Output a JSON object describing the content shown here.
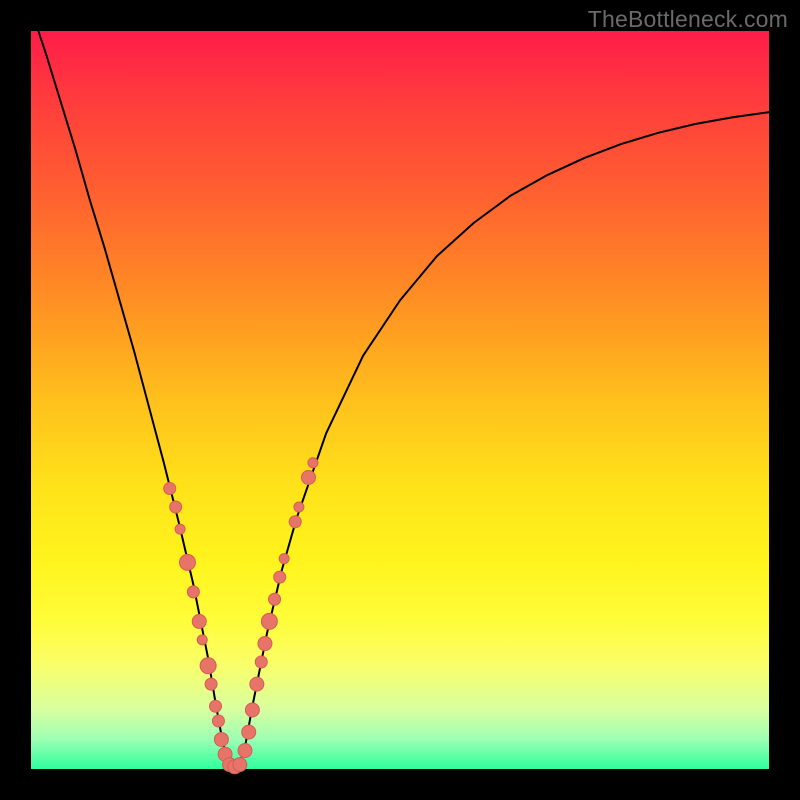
{
  "watermark": "TheBottleneck.com",
  "colors": {
    "frame": "#000000",
    "curve": "#000000",
    "scatter_fill": "#e77469",
    "scatter_stroke": "#d85c52"
  },
  "chart_data": {
    "type": "line",
    "title": "",
    "xlabel": "",
    "ylabel": "",
    "xlim": [
      0,
      100
    ],
    "ylim": [
      0,
      100
    ],
    "grid": false,
    "series": [
      {
        "name": "bottleneck-curve",
        "x": [
          0,
          2,
          4,
          6,
          8,
          10,
          12,
          14,
          16,
          18,
          20,
          22,
          24,
          25,
          26,
          27,
          28,
          29,
          30,
          32,
          34,
          36,
          40,
          45,
          50,
          55,
          60,
          65,
          70,
          75,
          80,
          85,
          90,
          95,
          100
        ],
        "y": [
          103,
          97,
          90.5,
          84,
          77,
          70.5,
          63.5,
          56.5,
          49,
          41.5,
          33.5,
          25,
          15,
          9,
          3.5,
          0,
          0,
          3,
          8.5,
          18.5,
          27,
          34,
          45.5,
          56,
          63.5,
          69.5,
          74,
          77.7,
          80.5,
          82.8,
          84.7,
          86.2,
          87.4,
          88.3,
          89
        ]
      }
    ],
    "scatter": {
      "name": "markers",
      "points": [
        {
          "x": 18.8,
          "y": 38.0,
          "r": 6
        },
        {
          "x": 19.6,
          "y": 35.5,
          "r": 6
        },
        {
          "x": 20.2,
          "y": 32.5,
          "r": 5
        },
        {
          "x": 21.2,
          "y": 28.0,
          "r": 8
        },
        {
          "x": 22.0,
          "y": 24.0,
          "r": 6
        },
        {
          "x": 22.8,
          "y": 20.0,
          "r": 7
        },
        {
          "x": 23.2,
          "y": 17.5,
          "r": 5
        },
        {
          "x": 24.0,
          "y": 14.0,
          "r": 8
        },
        {
          "x": 24.4,
          "y": 11.5,
          "r": 6
        },
        {
          "x": 25.0,
          "y": 8.5,
          "r": 6
        },
        {
          "x": 25.4,
          "y": 6.5,
          "r": 6
        },
        {
          "x": 25.8,
          "y": 4.0,
          "r": 7
        },
        {
          "x": 26.3,
          "y": 2.0,
          "r": 7
        },
        {
          "x": 26.9,
          "y": 0.6,
          "r": 7
        },
        {
          "x": 27.6,
          "y": 0.3,
          "r": 7
        },
        {
          "x": 28.3,
          "y": 0.6,
          "r": 7
        },
        {
          "x": 29.0,
          "y": 2.5,
          "r": 7
        },
        {
          "x": 29.5,
          "y": 5.0,
          "r": 7
        },
        {
          "x": 30.0,
          "y": 8.0,
          "r": 7
        },
        {
          "x": 30.6,
          "y": 11.5,
          "r": 7
        },
        {
          "x": 31.2,
          "y": 14.5,
          "r": 6
        },
        {
          "x": 31.7,
          "y": 17.0,
          "r": 7
        },
        {
          "x": 32.3,
          "y": 20.0,
          "r": 8
        },
        {
          "x": 33.0,
          "y": 23.0,
          "r": 6
        },
        {
          "x": 33.7,
          "y": 26.0,
          "r": 6
        },
        {
          "x": 34.3,
          "y": 28.5,
          "r": 5
        },
        {
          "x": 35.8,
          "y": 33.5,
          "r": 6
        },
        {
          "x": 36.3,
          "y": 35.5,
          "r": 5
        },
        {
          "x": 37.6,
          "y": 39.5,
          "r": 7
        },
        {
          "x": 38.2,
          "y": 41.5,
          "r": 5
        }
      ]
    }
  }
}
